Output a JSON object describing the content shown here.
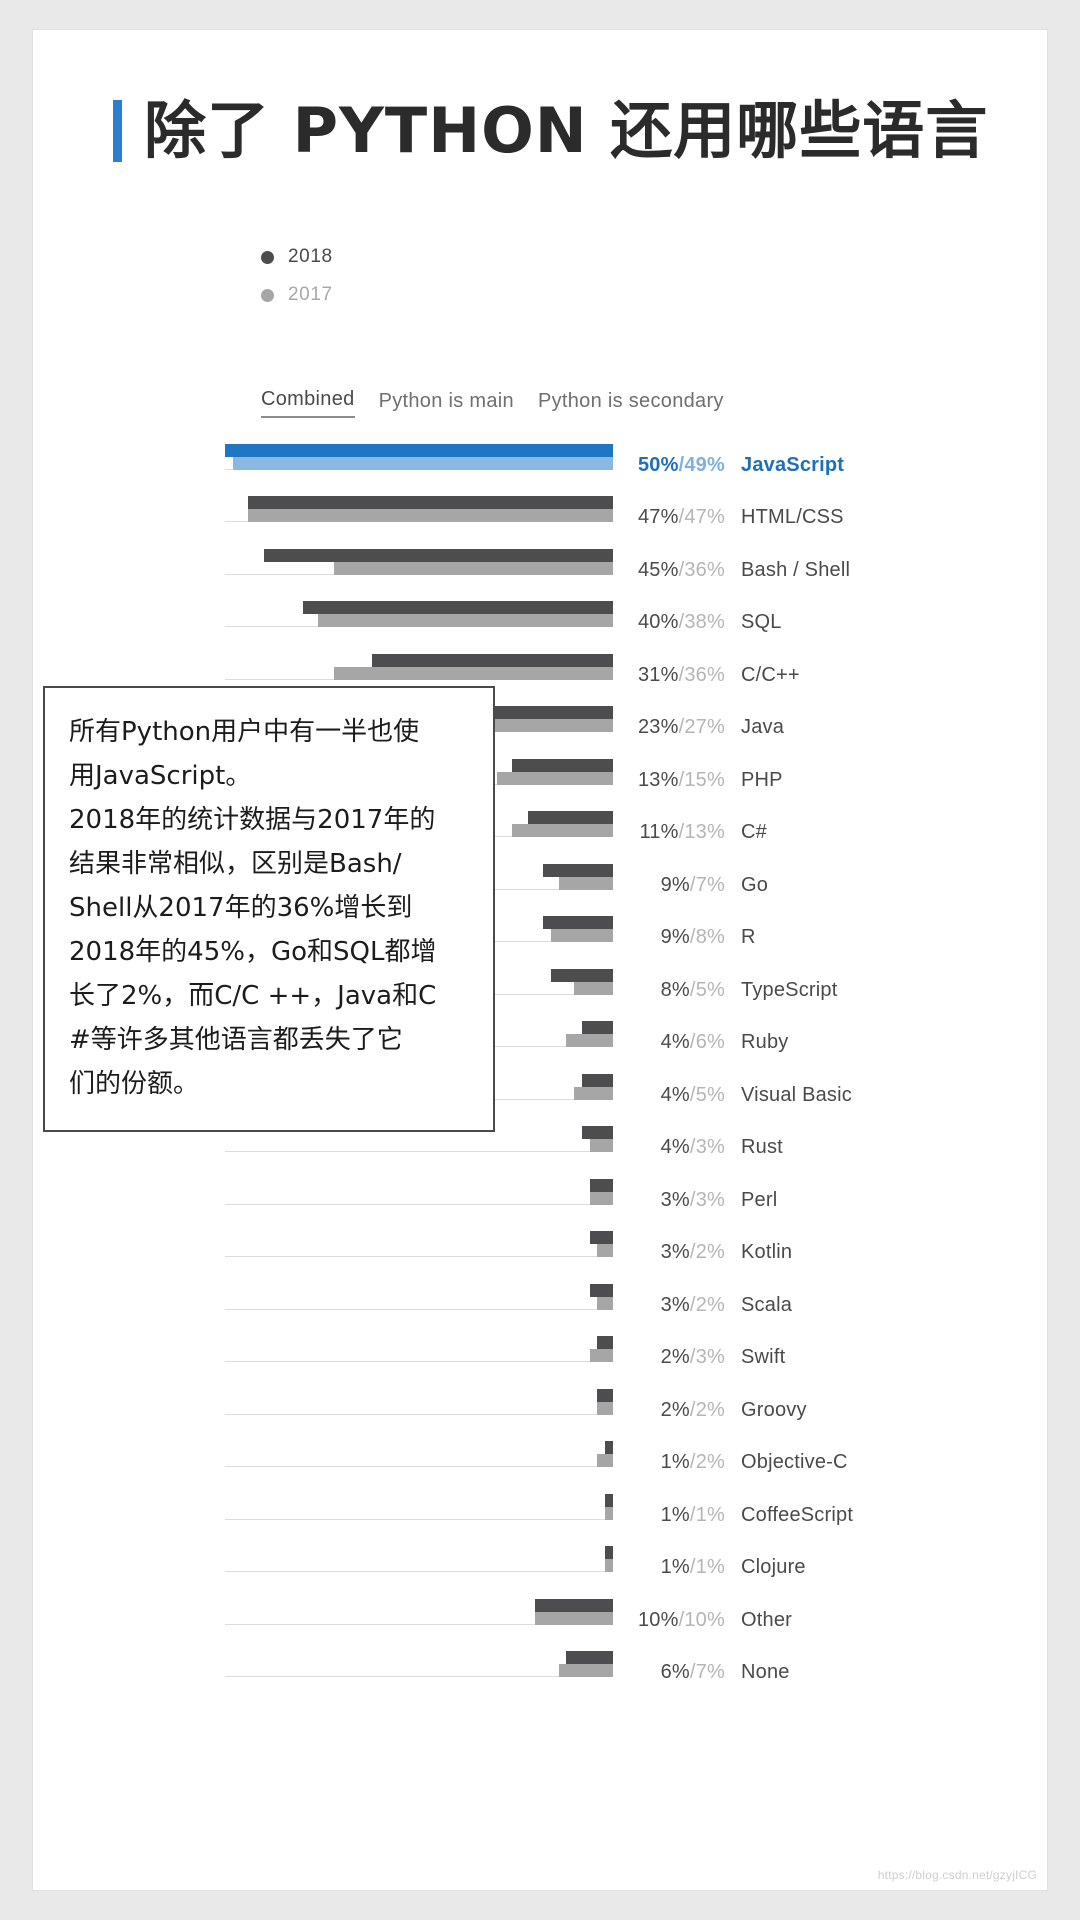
{
  "title": "除了 PYTHON 还用哪些语言",
  "accent_color": "#2b7fd0",
  "legend": [
    {
      "label": "2018",
      "color": "#4d4d4f"
    },
    {
      "label": "2017",
      "color": "#a6a6a6"
    }
  ],
  "tabs": [
    {
      "label": "Combined",
      "active": true
    },
    {
      "label": "Python is main",
      "active": false
    },
    {
      "label": "Python is secondary",
      "active": false
    }
  ],
  "annotation": {
    "lines": [
      "所有Python用户中有一半也使",
      "用JavaScript。",
      "2018年的统计数据与2017年的",
      "结果非常相似，区别是Bash/",
      "Shell从2017年的36%增长到",
      "2018年的45%，Go和SQL都增",
      "长了2%，而C/C ++，Java和C",
      "#等许多其他语言都丢失了它",
      "们的份额。"
    ]
  },
  "watermark": "https://blog.csdn.net/gzyjICG",
  "chart_data": {
    "type": "bar",
    "title": "除了 PYTHON 还用哪些语言",
    "xlabel": "",
    "ylabel": "",
    "orientation": "horizontal",
    "grid": false,
    "legend_position": "top-left",
    "xlim": [
      0,
      50
    ],
    "value_unit": "%",
    "categories": [
      "JavaScript",
      "HTML/CSS",
      "Bash / Shell",
      "SQL",
      "C/C++",
      "Java",
      "PHP",
      "C#",
      "Go",
      "R",
      "TypeScript",
      "Ruby",
      "Visual Basic",
      "Rust",
      "Perl",
      "Kotlin",
      "Scala",
      "Swift",
      "Groovy",
      "Objective-C",
      "CoffeeScript",
      "Clojure",
      "Other",
      "None"
    ],
    "series": [
      {
        "name": "2018",
        "color": "#4d4d4f",
        "values": [
          50,
          47,
          45,
          40,
          31,
          23,
          13,
          11,
          9,
          9,
          8,
          4,
          4,
          4,
          3,
          3,
          3,
          2,
          2,
          1,
          1,
          1,
          10,
          6
        ]
      },
      {
        "name": "2017",
        "color": "#a6a6a6",
        "values": [
          49,
          47,
          36,
          38,
          36,
          27,
          15,
          13,
          7,
          8,
          5,
          6,
          5,
          3,
          3,
          2,
          2,
          3,
          2,
          2,
          1,
          1,
          10,
          7
        ]
      }
    ],
    "highlight_category": "JavaScript",
    "highlight_color": "#1f77c4",
    "rows": [
      {
        "label": "JavaScript",
        "v2018": 50,
        "v2017": 49,
        "pct": "50%/49%",
        "highlight": true
      },
      {
        "label": "HTML/CSS",
        "v2018": 47,
        "v2017": 47,
        "pct": "47%/47%",
        "highlight": false
      },
      {
        "label": "Bash / Shell",
        "v2018": 45,
        "v2017": 36,
        "pct": "45%/36%",
        "highlight": false
      },
      {
        "label": "SQL",
        "v2018": 40,
        "v2017": 38,
        "pct": "40%/38%",
        "highlight": false
      },
      {
        "label": "C/C++",
        "v2018": 31,
        "v2017": 36,
        "pct": "31%/36%",
        "highlight": false
      },
      {
        "label": "Java",
        "v2018": 23,
        "v2017": 27,
        "pct": "23%/27%",
        "highlight": false
      },
      {
        "label": "PHP",
        "v2018": 13,
        "v2017": 15,
        "pct": "13%/15%",
        "highlight": false
      },
      {
        "label": "C#",
        "v2018": 11,
        "v2017": 13,
        "pct": "11%/13%",
        "highlight": false
      },
      {
        "label": "Go",
        "v2018": 9,
        "v2017": 7,
        "pct": "9%/7%",
        "highlight": false
      },
      {
        "label": "R",
        "v2018": 9,
        "v2017": 8,
        "pct": "9%/8%",
        "highlight": false
      },
      {
        "label": "TypeScript",
        "v2018": 8,
        "v2017": 5,
        "pct": "8%/5%",
        "highlight": false
      },
      {
        "label": "Ruby",
        "v2018": 4,
        "v2017": 6,
        "pct": "4%/6%",
        "highlight": false
      },
      {
        "label": "Visual Basic",
        "v2018": 4,
        "v2017": 5,
        "pct": "4%/5%",
        "highlight": false
      },
      {
        "label": "Rust",
        "v2018": 4,
        "v2017": 3,
        "pct": "4%/3%",
        "highlight": false
      },
      {
        "label": "Perl",
        "v2018": 3,
        "v2017": 3,
        "pct": "3%/3%",
        "highlight": false
      },
      {
        "label": "Kotlin",
        "v2018": 3,
        "v2017": 2,
        "pct": "3%/2%",
        "highlight": false
      },
      {
        "label": "Scala",
        "v2018": 3,
        "v2017": 2,
        "pct": "3%/2%",
        "highlight": false
      },
      {
        "label": "Swift",
        "v2018": 2,
        "v2017": 3,
        "pct": "2%/3%",
        "highlight": false
      },
      {
        "label": "Groovy",
        "v2018": 2,
        "v2017": 2,
        "pct": "2%/2%",
        "highlight": false
      },
      {
        "label": "Objective-C",
        "v2018": 1,
        "v2017": 2,
        "pct": "1%/2%",
        "highlight": false
      },
      {
        "label": "CoffeeScript",
        "v2018": 1,
        "v2017": 1,
        "pct": "1%/1%",
        "highlight": false
      },
      {
        "label": "Clojure",
        "v2018": 1,
        "v2017": 1,
        "pct": "1%/1%",
        "highlight": false
      },
      {
        "label": "Other",
        "v2018": 10,
        "v2017": 10,
        "pct": "10%/10%",
        "highlight": false
      },
      {
        "label": "None",
        "v2018": 6,
        "v2017": 7,
        "pct": "6%/7%",
        "highlight": false
      }
    ]
  }
}
